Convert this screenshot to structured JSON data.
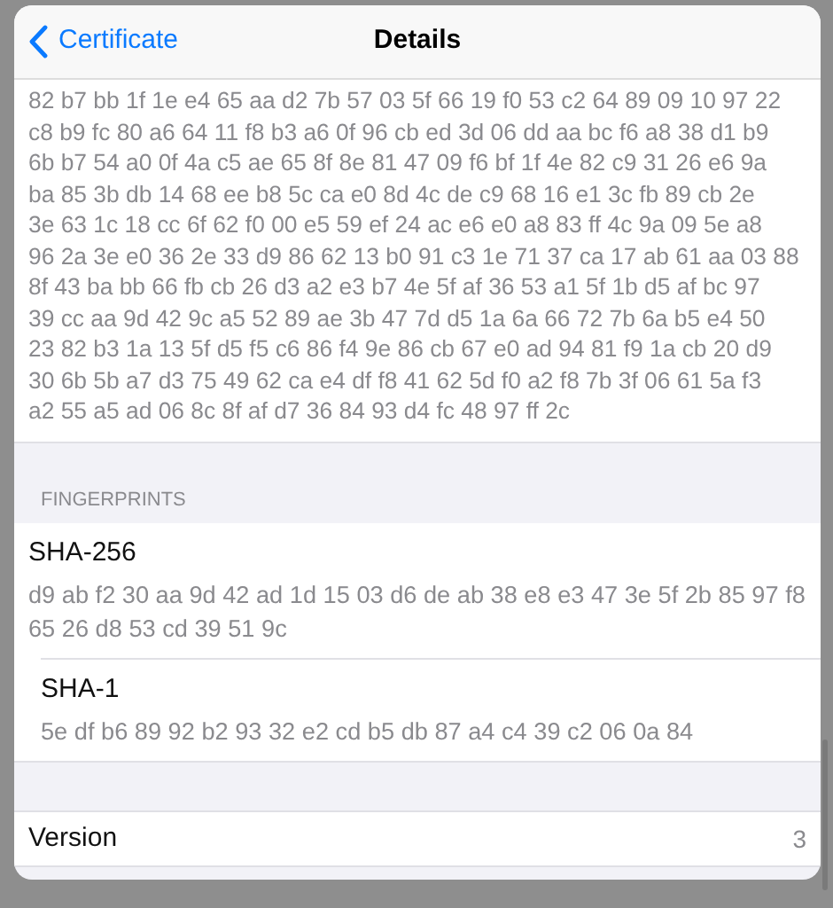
{
  "nav": {
    "back_label": "Certificate",
    "title": "Details"
  },
  "hex_block": {
    "lines": [
      "82 b7 bb 1f 1e e4 65 aa d2 7b 57 03 5f 66 19 f0 53 c2 64 89 09 10 97 22",
      "c8 b9 fc 80 a6 64 11 f8 b3 a6 0f 96 cb ed 3d 06 dd aa bc f6 a8 38 d1 b9",
      "6b b7 54 a0 0f 4a c5 ae 65 8f 8e 81 47 09 f6 bf 1f 4e 82 c9 31 26 e6 9a",
      "ba 85 3b db 14 68 ee b8 5c ca e0 8d 4c de c9 68 16 e1 3c fb 89 cb 2e",
      "3e 63 1c 18 cc 6f 62 f0 00 e5 59 ef 24 ac e6 e0 a8 83 ff 4c 9a 09 5e a8",
      "96 2a 3e e0 36 2e 33 d9 86 62 13 b0 91 c3 1e 71 37 ca 17 ab 61 aa 03 88",
      "8f 43 ba bb 66 fb cb 26 d3 a2 e3 b7 4e 5f af 36 53 a1 5f 1b d5 af bc 97",
      "39 cc aa 9d 42 9c a5 52 89 ae 3b 47 7d d5 1a 6a 66 72 7b 6a b5 e4 50",
      "23 82 b3 1a 13 5f d5 f5 c6 86 f4 9e 86 cb 67 e0 ad 94 81 f9 1a cb 20 d9",
      "30 6b 5b a7 d3 75 49 62 ca e4 df f8 41 62 5d f0 a2 f8 7b 3f 06 61 5a f3",
      "a2 55 a5 ad 06 8c 8f af d7 36 84 93 d4 fc 48 97 ff 2c"
    ]
  },
  "fingerprints": {
    "header": "FINGERPRINTS",
    "items": [
      {
        "label": "SHA-256",
        "value_lines": [
          "d9 ab f2 30 aa 9d 42 ad 1d 15 03 d6 de ab 38 e8 e3 47 3e 5f 2b 85 97 f8",
          "65 26 d8 53 cd 39 51 9c"
        ]
      },
      {
        "label": "SHA-1",
        "value_lines": [
          "5e df b6 89 92 b2 93 32 e2 cd b5 db 87 a4 c4 39 c2 06 0a 84"
        ]
      }
    ]
  },
  "version": {
    "label": "Version",
    "value": "3"
  }
}
